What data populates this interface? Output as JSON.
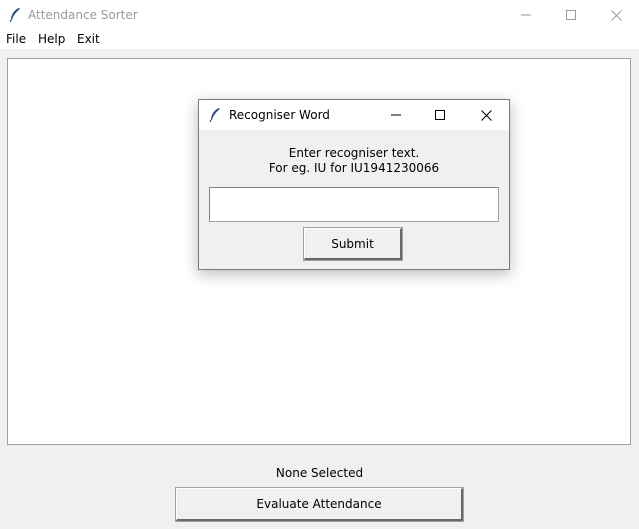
{
  "window": {
    "title": "Attendance Sorter",
    "app_icon": "feather-icon",
    "controls": [
      "minimize-icon",
      "maximize-icon",
      "close-icon"
    ]
  },
  "menubar": {
    "items": [
      {
        "label": "File"
      },
      {
        "label": "Help"
      },
      {
        "label": "Exit"
      }
    ]
  },
  "status": {
    "text": "None Selected"
  },
  "actions": {
    "evaluate_label": "Evaluate Attendance"
  },
  "dialog": {
    "title": "Recogniser Word",
    "prompt_line1": "Enter recogniser text.",
    "prompt_line2": "For eg. IU for IU1941230066",
    "input_value": "",
    "submit_label": "Submit"
  },
  "colors": {
    "title_text_inactive": "#9a9a9a",
    "background": "#f0f0f0",
    "content_bg": "#ffffff",
    "border": "#a0a0a0"
  }
}
